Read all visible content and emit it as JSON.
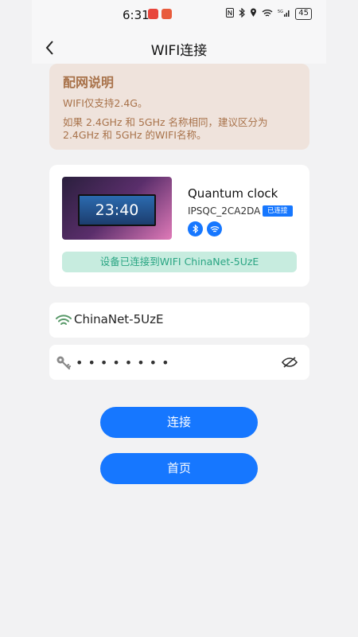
{
  "status_bar": {
    "time": "6:31",
    "battery": "45",
    "network": "5G"
  },
  "header": {
    "title": "WIFI连接"
  },
  "notice": {
    "title": "配网说明",
    "line1": "WIFI仅支持2.4G。",
    "line2": "如果 2.4GHz 和 5GHz 名称相同，建议区分为",
    "line3": "2.4GHz 和 5GHz 的WIFI名称。"
  },
  "device": {
    "screen_time": "23:40",
    "name": "Quantum clock",
    "id": "IPSQC_2CA2DA",
    "status": "已连接",
    "connected_message": "设备已连接到WIFI ChinaNet-5UzE"
  },
  "wifi": {
    "ssid": "ChinaNet-5UzE",
    "password_display": "••••••••"
  },
  "buttons": {
    "connect": "连接",
    "home": "首页"
  },
  "colors": {
    "accent": "#1677ff",
    "notice_bg": "#efe3dc",
    "notice_text": "#a8724a",
    "success_bg": "#c7ecdf",
    "success_text": "#2aa583"
  }
}
